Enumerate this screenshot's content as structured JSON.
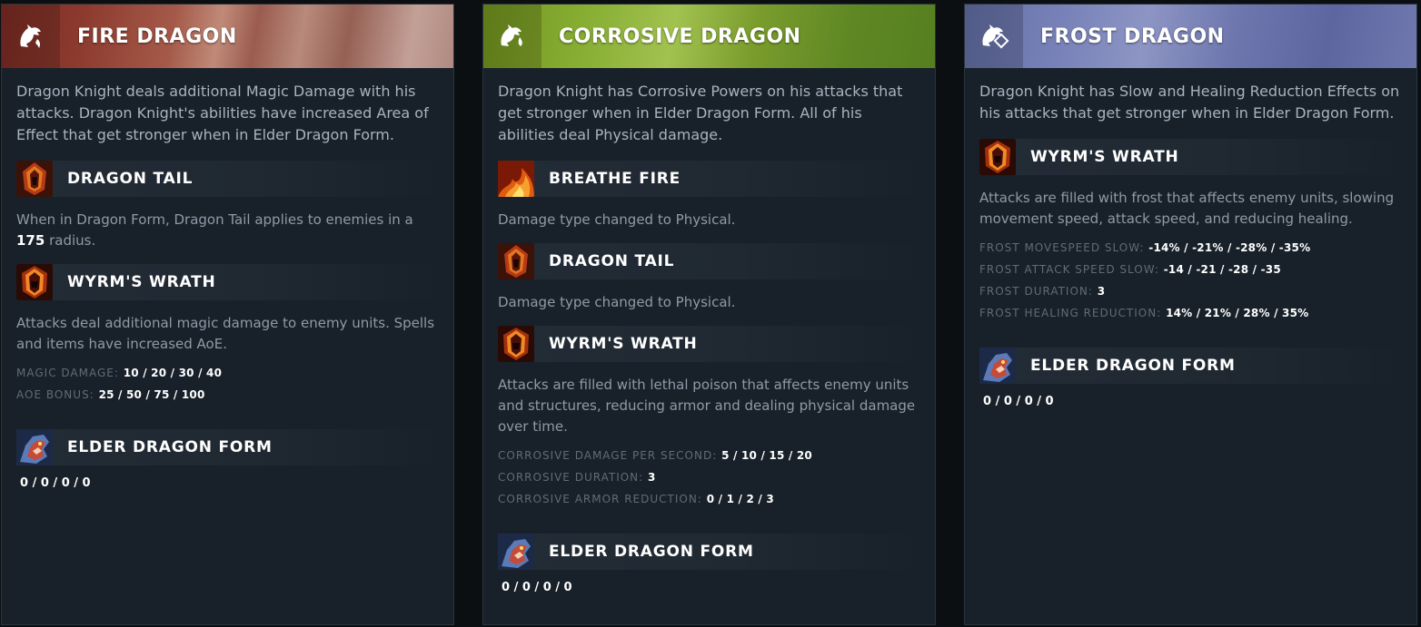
{
  "panels": [
    {
      "title": "FIRE DRAGON",
      "header_icon": "fire-dragon-icon",
      "description": "Dragon Knight deals additional Magic Damage with his attacks. Dragon Knight's abilities have increased Area of Effect that get stronger when in Elder Dragon Form.",
      "abilities": [
        {
          "name": "DRAGON TAIL",
          "icon": "dragon-tail-icon",
          "desc_pre": "When in Dragon Form, Dragon Tail applies to enemies in a ",
          "desc_bold": "175",
          "desc_post": " radius."
        },
        {
          "name": "WYRM'S WRATH",
          "icon": "wyrms-wrath-icon",
          "desc": "Attacks deal additional magic damage to enemy units. Spells and items have increased AoE.",
          "stats": [
            {
              "label": "MAGIC DAMAGE:",
              "value": "10 / 20 / 30 / 40"
            },
            {
              "label": "AOE BONUS:",
              "value": "25 / 50 / 75 / 100"
            }
          ]
        },
        {
          "name": "ELDER DRAGON FORM",
          "icon": "elder-dragon-form-icon",
          "value": "0 / 0 / 0 / 0"
        }
      ]
    },
    {
      "title": "CORROSIVE DRAGON",
      "header_icon": "corrosive-dragon-icon",
      "description": "Dragon Knight has Corrosive Powers on his attacks that get stronger when in Elder Dragon Form. All of his abilities deal Physical damage.",
      "abilities": [
        {
          "name": "BREATHE FIRE",
          "icon": "breathe-fire-icon",
          "desc": "Damage type changed to Physical."
        },
        {
          "name": "DRAGON TAIL",
          "icon": "dragon-tail-icon",
          "desc": "Damage type changed to Physical."
        },
        {
          "name": "WYRM'S WRATH",
          "icon": "wyrms-wrath-icon",
          "desc": "Attacks are filled with lethal poison that affects enemy units and structures, reducing armor and dealing physical damage over time.",
          "stats": [
            {
              "label": "CORROSIVE DAMAGE PER SECOND:",
              "value": "5 / 10 / 15 / 20"
            },
            {
              "label": "CORROSIVE DURATION:",
              "value": "3"
            },
            {
              "label": "CORROSIVE ARMOR REDUCTION:",
              "value": "0 / 1 / 2 / 3"
            }
          ]
        },
        {
          "name": "ELDER DRAGON FORM",
          "icon": "elder-dragon-form-icon",
          "value": "0 / 0 / 0 / 0"
        }
      ]
    },
    {
      "title": "FROST DRAGON",
      "header_icon": "frost-dragon-icon",
      "description": "Dragon Knight has Slow and Healing Reduction Effects on his attacks that get stronger when in Elder Dragon Form.",
      "abilities": [
        {
          "name": "WYRM'S WRATH",
          "icon": "wyrms-wrath-icon",
          "desc": "Attacks are filled with frost that affects enemy units, slowing movement speed, attack speed, and reducing healing.",
          "stats": [
            {
              "label": "FROST MOVESPEED SLOW:",
              "value": "-14% / -21% / -28% / -35%"
            },
            {
              "label": "FROST ATTACK SPEED SLOW:",
              "value": "-14 / -21 / -28 / -35"
            },
            {
              "label": "FROST DURATION:",
              "value": "3"
            },
            {
              "label": "FROST HEALING REDUCTION:",
              "value": "14% / 21% / 28% / 35%"
            }
          ]
        },
        {
          "name": "ELDER DRAGON FORM",
          "icon": "elder-dragon-form-icon",
          "value": "0 / 0 / 0 / 0"
        }
      ]
    }
  ]
}
